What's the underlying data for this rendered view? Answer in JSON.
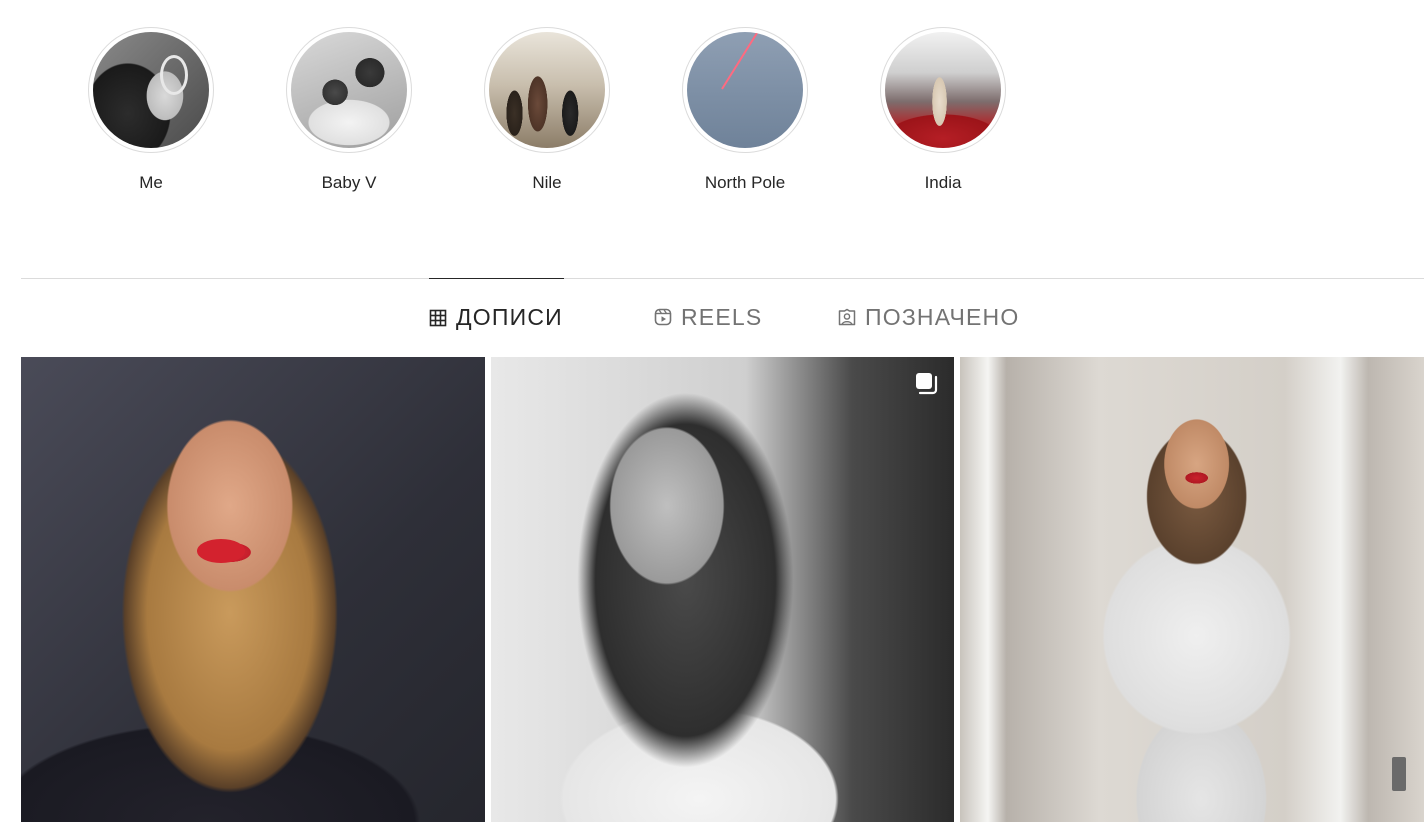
{
  "highlights": [
    {
      "label": "Me"
    },
    {
      "label": "Baby V"
    },
    {
      "label": "Nile"
    },
    {
      "label": "North Pole"
    },
    {
      "label": "India"
    }
  ],
  "tabs": {
    "posts": {
      "label": "ДОПИСИ",
      "icon": "grid-icon",
      "active": true
    },
    "reels": {
      "label": "REELS",
      "icon": "reels-icon",
      "active": false
    },
    "tagged": {
      "label": "ПОЗНАЧЕНО",
      "icon": "tagged-icon",
      "active": false
    }
  },
  "posts": [
    {
      "type": "photo",
      "icon": null
    },
    {
      "type": "carousel",
      "icon": "carousel-icon"
    },
    {
      "type": "photo",
      "icon": null
    }
  ],
  "colors": {
    "text_primary": "#262626",
    "text_secondary": "#737373",
    "divider": "#dbdbdb",
    "background": "#ffffff"
  }
}
